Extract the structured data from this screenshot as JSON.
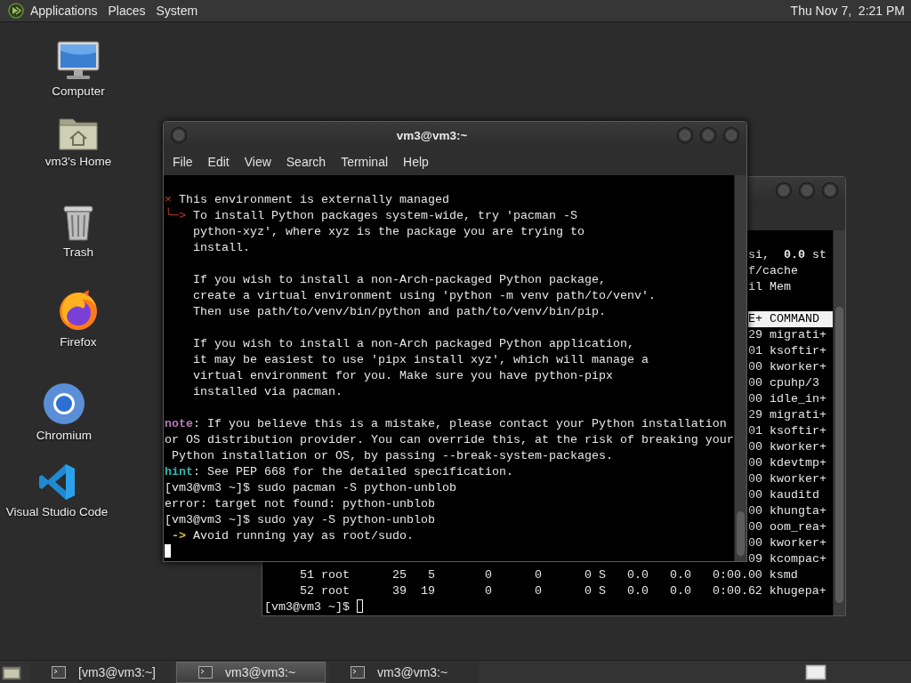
{
  "top_panel": {
    "menus": [
      "Applications",
      "Places",
      "System"
    ],
    "clock": "Thu Nov 7,  2:21 PM"
  },
  "desktop_icons": [
    {
      "label": "Computer",
      "kind": "computer"
    },
    {
      "label": "vm3's Home",
      "kind": "home"
    },
    {
      "label": "Trash",
      "kind": "trash"
    },
    {
      "label": "Firefox",
      "kind": "firefox"
    },
    {
      "label": "Chromium",
      "kind": "chromium"
    },
    {
      "label": "Visual Studio Code",
      "kind": "vscode"
    }
  ],
  "back_terminal": {
    "right_lines": [
      {
        "kind": "row",
        "text": "si,  **0.0** st"
      },
      {
        "kind": "row",
        "text": "f/cache"
      },
      {
        "kind": "row",
        "text": "il Mem"
      },
      {
        "kind": "blank"
      },
      {
        "kind": "header",
        "text": "E+ COMMAND"
      },
      {
        "kind": "row",
        "text": "29 migrati+"
      },
      {
        "kind": "row",
        "text": "01 ksoftir+"
      },
      {
        "kind": "row",
        "text": "00 kworker+"
      },
      {
        "kind": "row",
        "text": "00 cpuhp/3"
      },
      {
        "kind": "row",
        "text": "00 idle_in+"
      },
      {
        "kind": "row",
        "text": "29 migrati+"
      },
      {
        "kind": "row",
        "text": "01 ksoftir+"
      },
      {
        "kind": "row",
        "text": "00 kworker+"
      },
      {
        "kind": "row",
        "text": "00 kdevtmp+"
      },
      {
        "kind": "row",
        "text": "00 kworker+"
      },
      {
        "kind": "row",
        "text": "00 kauditd"
      },
      {
        "kind": "row",
        "text": "00 khungta+"
      },
      {
        "kind": "row",
        "text": "00 oom_rea+"
      },
      {
        "kind": "row",
        "text": "00 kworker+"
      },
      {
        "kind": "row",
        "text": "09 kcompac+"
      }
    ],
    "lines": [
      "     51 root      25   5       0      0      0 S   0.0   0.0   0:00.00 ksmd",
      "     52 root      39  19       0      0      0 S   0.0   0.0   0:00.62 khugepa+"
    ],
    "prompt": "[vm3@vm3 ~]$",
    "focused": false
  },
  "front_terminal": {
    "title": "vm3@vm3:~",
    "menu": [
      "File",
      "Edit",
      "View",
      "Search",
      "Terminal",
      "Help"
    ],
    "lines": [
      {
        "kind": "text",
        "segments": [
          {
            "kind": "mark",
            "text": "×"
          },
          {
            "kind": "plain",
            "text": " This environment is externally managed"
          }
        ]
      },
      {
        "kind": "text",
        "segments": [
          {
            "kind": "mark",
            "text": "╰─>"
          },
          {
            "kind": "plain",
            "text": " To install Python packages system-wide, try 'pacman -S"
          }
        ]
      },
      {
        "kind": "text",
        "segments": [
          {
            "kind": "plain",
            "text": "    python-xyz', where xyz is the package you are trying to"
          }
        ]
      },
      {
        "kind": "text",
        "segments": [
          {
            "kind": "plain",
            "text": "    install."
          }
        ]
      },
      {
        "kind": "blank"
      },
      {
        "kind": "text",
        "segments": [
          {
            "kind": "plain",
            "text": "    If you wish to install a non-Arch-packaged Python package,"
          }
        ]
      },
      {
        "kind": "text",
        "segments": [
          {
            "kind": "plain",
            "text": "    create a virtual environment using 'python -m venv path/to/venv'."
          }
        ]
      },
      {
        "kind": "text",
        "segments": [
          {
            "kind": "plain",
            "text": "    Then use path/to/venv/bin/python and path/to/venv/bin/pip."
          }
        ]
      },
      {
        "kind": "blank"
      },
      {
        "kind": "text",
        "segments": [
          {
            "kind": "plain",
            "text": "    If you wish to install a non-Arch packaged Python application,"
          }
        ]
      },
      {
        "kind": "text",
        "segments": [
          {
            "kind": "plain",
            "text": "    it may be easiest to use 'pipx install xyz', which will manage a"
          }
        ]
      },
      {
        "kind": "text",
        "segments": [
          {
            "kind": "plain",
            "text": "    virtual environment for you. Make sure you have python-pipx"
          }
        ]
      },
      {
        "kind": "text",
        "segments": [
          {
            "kind": "plain",
            "text": "    installed via pacman."
          }
        ]
      },
      {
        "kind": "blank"
      },
      {
        "kind": "text",
        "segments": [
          {
            "kind": "note",
            "text": "note"
          },
          {
            "kind": "plain",
            "text": ": If you believe this is a mistake, please contact your Python installation"
          }
        ]
      },
      {
        "kind": "text",
        "segments": [
          {
            "kind": "plain",
            "text": "or OS distribution provider. You can override this, at the risk of breaking your"
          }
        ]
      },
      {
        "kind": "text",
        "segments": [
          {
            "kind": "plain",
            "text": " Python installation or OS, by passing --break-system-packages."
          }
        ]
      },
      {
        "kind": "text",
        "segments": [
          {
            "kind": "hint",
            "text": "hint"
          },
          {
            "kind": "plain",
            "text": ": See PEP 668 for the detailed specification."
          }
        ]
      },
      {
        "kind": "text",
        "segments": [
          {
            "kind": "plain",
            "text": "[vm3@vm3 ~]$ sudo pacman -S python-unblob"
          }
        ]
      },
      {
        "kind": "text",
        "segments": [
          {
            "kind": "plain",
            "text": "error: target not found: python-unblob"
          }
        ]
      },
      {
        "kind": "text",
        "segments": [
          {
            "kind": "plain",
            "text": "[vm3@vm3 ~]$ sudo yay -S python-unblob"
          }
        ]
      },
      {
        "kind": "text",
        "segments": [
          {
            "kind": "arrow",
            "text": " ->"
          },
          {
            "kind": "plain",
            "text": " Avoid running yay as root/sudo."
          }
        ]
      }
    ],
    "focused": true
  },
  "taskbar": {
    "tasks": [
      {
        "label": "[vm3@vm3:~]",
        "selected": false
      },
      {
        "label": "vm3@vm3:~",
        "selected": true
      },
      {
        "label": "vm3@vm3:~",
        "selected": false
      }
    ]
  }
}
